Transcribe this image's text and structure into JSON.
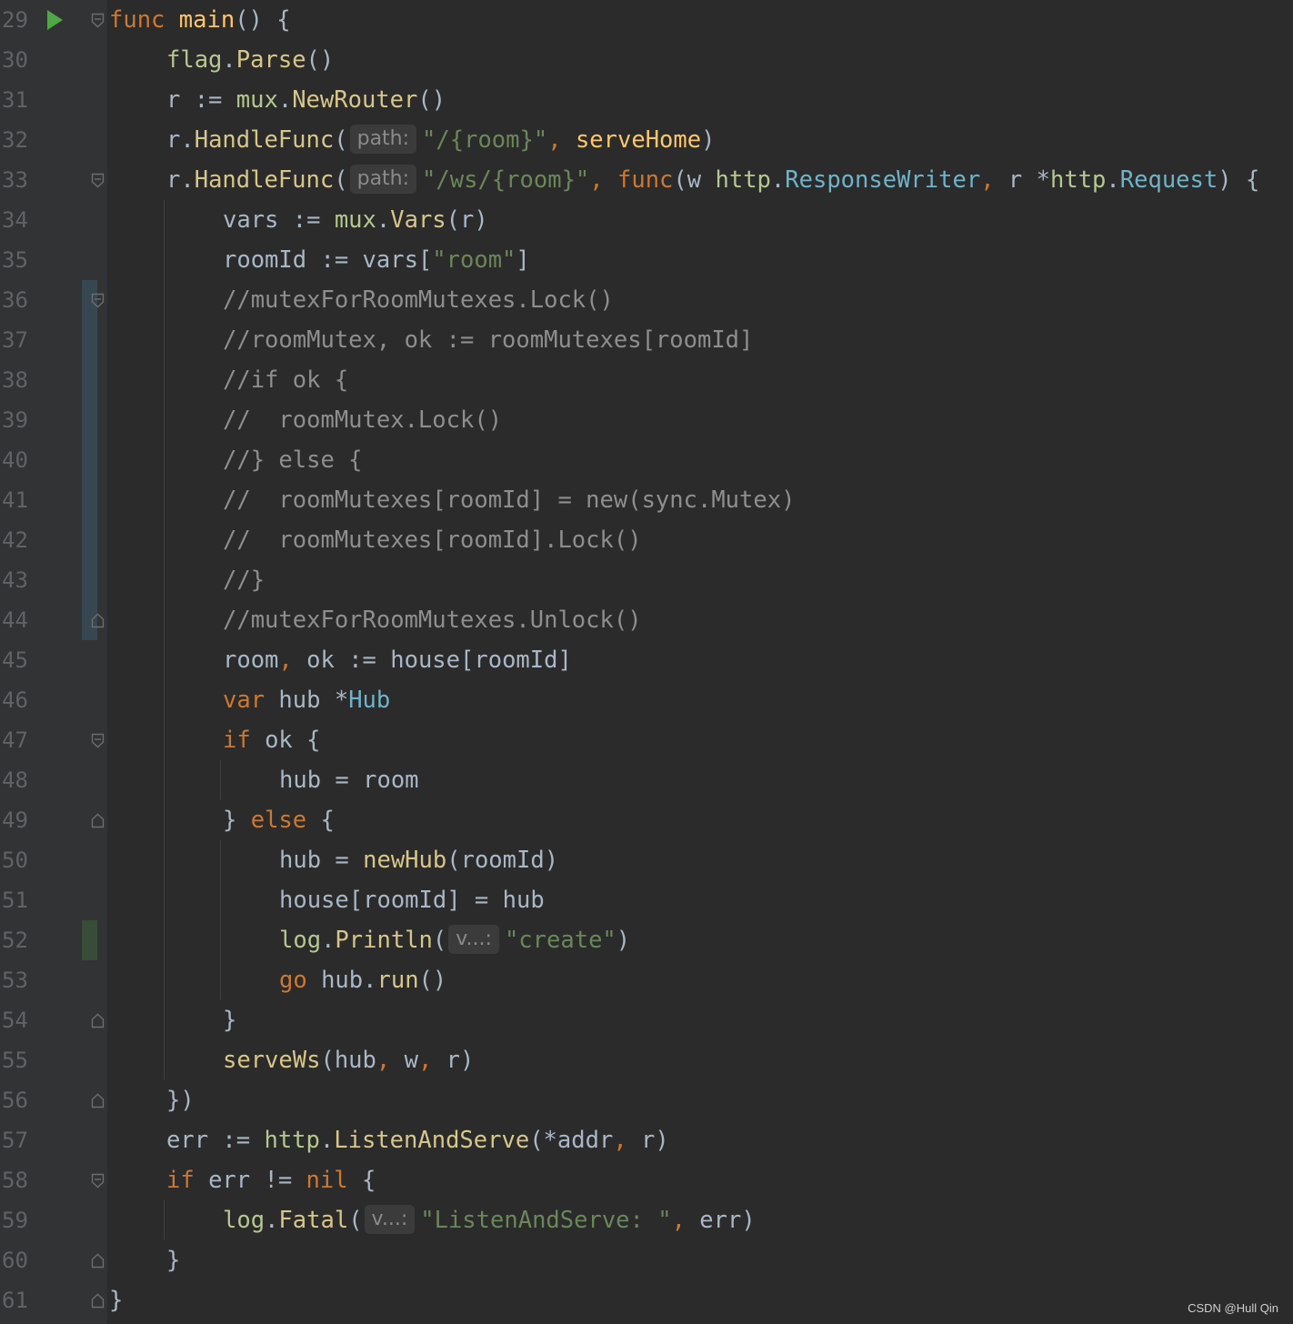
{
  "editor": {
    "lines": [
      {
        "num": "29"
      },
      {
        "num": "30"
      },
      {
        "num": "31"
      },
      {
        "num": "32"
      },
      {
        "num": "33"
      },
      {
        "num": "34"
      },
      {
        "num": "35"
      },
      {
        "num": "36"
      },
      {
        "num": "37"
      },
      {
        "num": "38"
      },
      {
        "num": "39"
      },
      {
        "num": "40"
      },
      {
        "num": "41"
      },
      {
        "num": "42"
      },
      {
        "num": "43"
      },
      {
        "num": "44"
      },
      {
        "num": "45"
      },
      {
        "num": "46"
      },
      {
        "num": "47"
      },
      {
        "num": "48"
      },
      {
        "num": "49"
      },
      {
        "num": "50"
      },
      {
        "num": "51"
      },
      {
        "num": "52"
      },
      {
        "num": "53"
      },
      {
        "num": "54"
      },
      {
        "num": "55"
      },
      {
        "num": "56"
      },
      {
        "num": "57"
      },
      {
        "num": "58"
      },
      {
        "num": "59"
      },
      {
        "num": "60"
      },
      {
        "num": "61"
      }
    ],
    "tokens": {
      "l29": {
        "func": "func",
        "main": "main",
        "rest": "() {"
      },
      "l30": {
        "flag": "flag",
        "dot": ".",
        "parse": "Parse",
        "rest": "()"
      },
      "l31": {
        "a": "r := ",
        "mux": "mux",
        "dot": ".",
        "newrouter": "NewRouter",
        "rest": "()"
      },
      "l32": {
        "a": "r.",
        "hf": "HandleFunc",
        "b": "(",
        "hint": "path:",
        "str": "\"/{room}\"",
        "comma": ",",
        "sp": " ",
        "serve": "serveHome",
        "rest": ")"
      },
      "l33": {
        "a": "r.",
        "hf": "HandleFunc",
        "b": "(",
        "hint": "path:",
        "str": "\"/ws/{room}\"",
        "comma": ",",
        "sp": " ",
        "func": "func",
        "c": "(w ",
        "http1": "http",
        "d1": ".",
        "rw": "ResponseWriter",
        "comma2": ",",
        "e": " r *",
        "http2": "http",
        "d2": ".",
        "req": "Request",
        "rest": ") {"
      },
      "l34": {
        "a": "vars := ",
        "mux": "mux",
        "dot": ".",
        "vars": "Vars",
        "rest": "(r)"
      },
      "l35": {
        "a": "roomId := vars[",
        "str": "\"room\"",
        "rest": "]"
      },
      "l36": {
        "cm": "//mutexForRoomMutexes.Lock()"
      },
      "l37": {
        "cm": "//roomMutex, ok := roomMutexes[roomId]"
      },
      "l38": {
        "cm": "//if ok {"
      },
      "l39": {
        "cm": "//  roomMutex.Lock()"
      },
      "l40": {
        "cm": "//} else {"
      },
      "l41": {
        "cm": "//  roomMutexes[roomId] = new(sync.Mutex)"
      },
      "l42": {
        "cm": "//  roomMutexes[roomId].Lock()"
      },
      "l43": {
        "cm": "//}"
      },
      "l44": {
        "cm": "//mutexForRoomMutexes.Unlock()"
      },
      "l45": {
        "a": "room",
        "comma": ",",
        "rest": " ok := house[roomId]"
      },
      "l46": {
        "var": "var",
        "a": " hub *",
        "hub": "Hub"
      },
      "l47": {
        "if": "if",
        "rest": " ok {"
      },
      "l48": {
        "a": "hub = room"
      },
      "l49": {
        "a": "} ",
        "else": "else",
        "rest": " {"
      },
      "l50": {
        "a": "hub = ",
        "newhub": "newHub",
        "rest": "(roomId)"
      },
      "l51": {
        "a": "house[roomId] = hub"
      },
      "l52": {
        "log": "log",
        "dot": ".",
        "println": "Println",
        "b": "(",
        "hint": "v...:",
        "str": "\"create\"",
        "rest": ")"
      },
      "l53": {
        "go": "go",
        "a": " hub.",
        "run": "run",
        "rest": "()"
      },
      "l54": {
        "a": "}"
      },
      "l55": {
        "servews": "serveWs",
        "a": "(hub",
        "c1": ",",
        "b": " w",
        "c2": ",",
        "rest": " r)"
      },
      "l56": {
        "a": "})"
      },
      "l57": {
        "a": "err := ",
        "http": "http",
        "dot": ".",
        "las": "ListenAndServe",
        "b": "(*addr",
        "comma": ",",
        "rest": " r)"
      },
      "l58": {
        "if": "if",
        "a": " err != ",
        "nil": "nil",
        "rest": " {"
      },
      "l59": {
        "log": "log",
        "dot": ".",
        "fatal": "Fatal",
        "b": "(",
        "hint": "v...:",
        "str": "\"ListenAndServe: \"",
        "comma": ",",
        "rest": " err)"
      },
      "l60": {
        "a": "}"
      },
      "l61": {
        "a": "}"
      }
    }
  },
  "watermark": "CSDN @Hull Qin",
  "colors": {
    "background": "#2b2b2b",
    "gutter": "#313335",
    "keyword": "#cc7832",
    "function": "#ffc66d",
    "string": "#6a8759",
    "comment": "#8e8e8e",
    "type": "#6fb3c9",
    "modified_marker": "#374752",
    "added_marker": "#384c38",
    "run_icon": "#4fa845"
  },
  "icons": [
    "run-icon",
    "fold-icon"
  ]
}
